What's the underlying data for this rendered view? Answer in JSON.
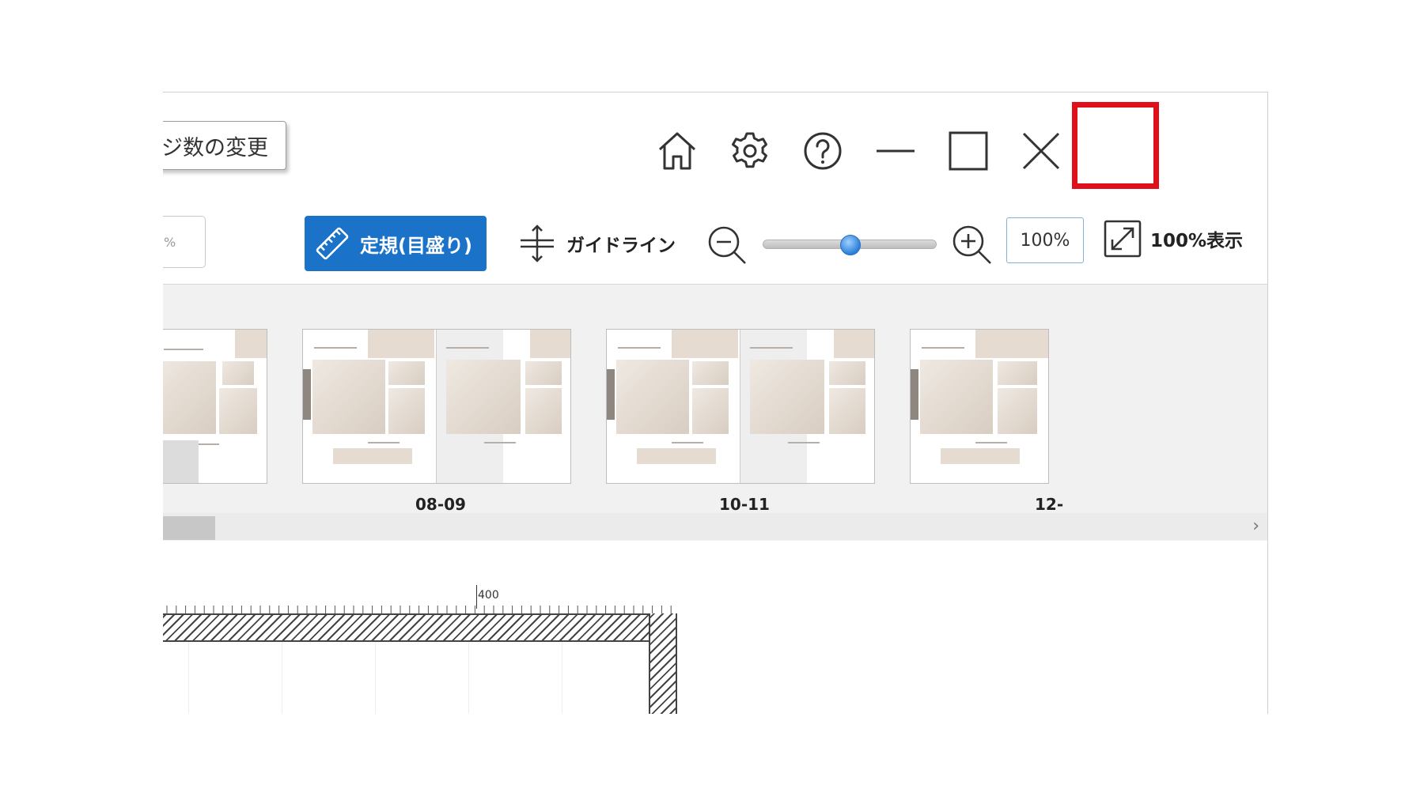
{
  "titlebar": {
    "pages_button_label": "ジ数の変更",
    "icons": [
      "home-icon",
      "gear-icon",
      "help-icon",
      "minimize-icon",
      "maximize-icon",
      "close-icon"
    ],
    "highlight_color": "#e0101a"
  },
  "toolbar": {
    "left_field_value": "%",
    "ruler_button_label": "定規(目盛り)",
    "guideline_label": "ガイドライン",
    "zoom_value": "100%",
    "zoom_slider_fraction": 0.5,
    "fit_label": "100%表示",
    "accent_color": "#1a73c9"
  },
  "strip": {
    "spreads": [
      {
        "label": ""
      },
      {
        "label": "08-09"
      },
      {
        "label": "10-11"
      },
      {
        "label": "12-"
      }
    ]
  },
  "canvas": {
    "ruler_label": "400"
  }
}
